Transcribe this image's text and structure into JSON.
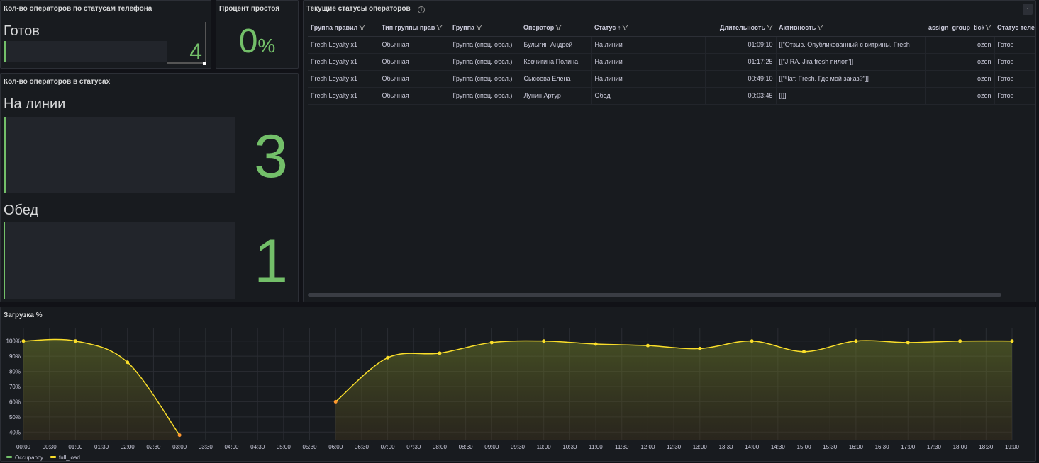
{
  "phone_panel": {
    "title": "Кол-во операторов по статусам телефона",
    "label": "Готов",
    "value": "4",
    "fill": 0.5
  },
  "idle_panel": {
    "title": "Процент простоя",
    "value": "0",
    "unit": "%"
  },
  "status_panel": {
    "title": "Кол-во операторов в статусах",
    "items": [
      {
        "label": "На линии",
        "value": "3"
      },
      {
        "label": "Обед",
        "value": "1"
      }
    ]
  },
  "table_panel": {
    "title": "Текущие статусы операторов",
    "columns": [
      "Группа правил",
      "Тип группы прав",
      "Группа",
      "Оператор",
      "Статус",
      "Длительность",
      "Активность",
      "assign_group_tick",
      "Статус теле"
    ],
    "rows": [
      [
        "Fresh Loyalty x1",
        "Обычная",
        "Группа (спец. обсл.)",
        "Булыгин Андрей",
        "На линии",
        "01:09:10",
        "[[\"Отзыв. Опубликованный с витрины. Fresh",
        "ozon",
        "Готов"
      ],
      [
        "Fresh Loyalty x1",
        "Обычная",
        "Группа (спец. обсл.)",
        "Ковчигина Полина",
        "На линии",
        "01:17:25",
        "[[\"JIRA. Jira fresh пилот\"]]",
        "ozon",
        "Готов"
      ],
      [
        "Fresh Loyalty x1",
        "Обычная",
        "Группа (спец. обсл.)",
        "Сысоева Елена",
        "На линии",
        "00:49:10",
        "[[\"Чат. Fresh. Где мой заказ?\"]]",
        "ozon",
        "Готов"
      ],
      [
        "Fresh Loyalty x1",
        "Обычная",
        "Группа (спец. обсл.)",
        "Лунин Артур",
        "Обед",
        "00:03:45",
        "[[]]",
        "ozon",
        "Готов"
      ]
    ]
  },
  "chart_panel": {
    "title": "Загрузка %"
  },
  "colors": {
    "accent": "#73bf69",
    "line": "#fade2a",
    "line_low": "#ff9830"
  },
  "chart_data": {
    "type": "line",
    "x_ticks": [
      "00:00",
      "00:30",
      "01:00",
      "01:30",
      "02:00",
      "02:30",
      "03:00",
      "03:30",
      "04:00",
      "04:30",
      "05:00",
      "05:30",
      "06:00",
      "06:30",
      "07:00",
      "07:30",
      "08:00",
      "08:30",
      "09:00",
      "09:30",
      "10:00",
      "10:30",
      "11:00",
      "11:30",
      "12:00",
      "12:30",
      "13:00",
      "13:30",
      "14:00",
      "14:30",
      "15:00",
      "15:30",
      "16:00",
      "16:30",
      "17:00",
      "17:30",
      "18:00",
      "18:30",
      "19:00"
    ],
    "y_ticks": [
      "40%",
      "50%",
      "60%",
      "70%",
      "80%",
      "90%",
      "100%"
    ],
    "ylim": [
      35,
      105
    ],
    "series": [
      {
        "name": "Occupancy",
        "values": []
      },
      {
        "name": "full_load",
        "segments": [
          [
            [
              "00:00",
              100
            ],
            [
              "01:00",
              100
            ],
            [
              "02:00",
              86
            ],
            [
              "03:00",
              38
            ]
          ],
          [
            [
              "06:00",
              60
            ],
            [
              "07:00",
              89
            ],
            [
              "08:00",
              92
            ],
            [
              "09:00",
              99
            ],
            [
              "10:00",
              100
            ],
            [
              "11:00",
              98
            ],
            [
              "12:00",
              97
            ],
            [
              "13:00",
              95
            ],
            [
              "14:00",
              100
            ],
            [
              "15:00",
              93
            ],
            [
              "16:00",
              100
            ],
            [
              "17:00",
              99
            ],
            [
              "18:00",
              100
            ],
            [
              "19:00",
              100
            ]
          ]
        ]
      }
    ],
    "legend": "bottom-left"
  }
}
